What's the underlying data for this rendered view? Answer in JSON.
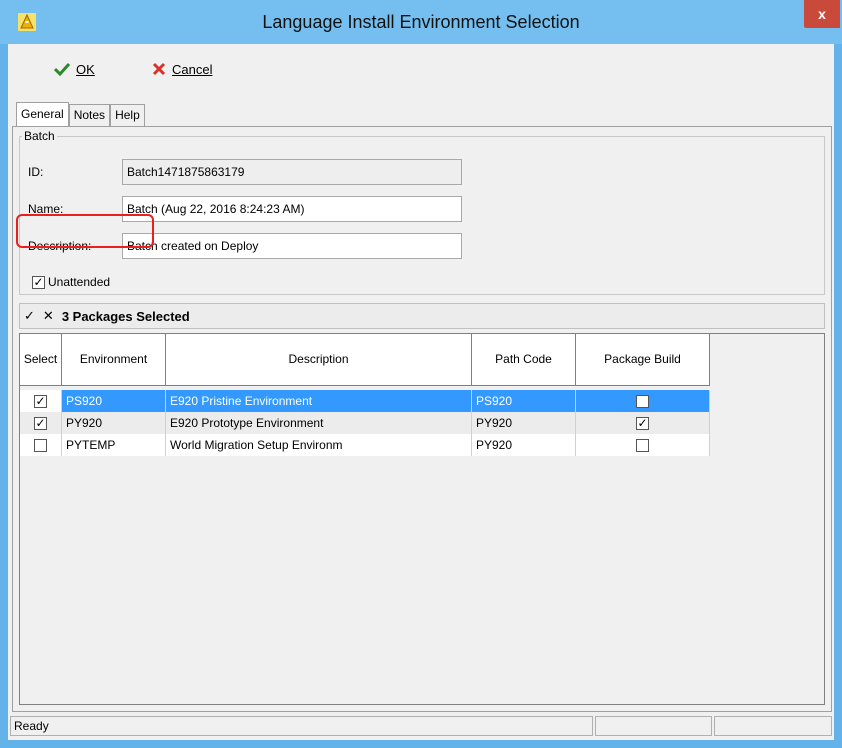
{
  "window": {
    "title": "Language Install Environment Selection",
    "close_label": "x",
    "accent": "#74bff0"
  },
  "toolbar": {
    "ok_label": "OK",
    "cancel_label": "Cancel"
  },
  "tabs": [
    {
      "label": "General",
      "active": true
    },
    {
      "label": "Notes",
      "active": false
    },
    {
      "label": "Help",
      "active": false
    }
  ],
  "batch": {
    "legend": "Batch",
    "id_label": "ID:",
    "id_value": "Batch1471875863179",
    "name_label": "Name:",
    "name_value": "Batch (Aug 22, 2016 8:24:23 AM)",
    "description_label": "Description:",
    "description_value": "Batch created on Deploy",
    "unattended_label": "Unattended",
    "unattended_checked": true
  },
  "selection_bar": {
    "check_all_icon": "checkmark-icon",
    "clear_all_icon": "x-icon",
    "summary": "3 Packages Selected"
  },
  "grid": {
    "headers": [
      "Select",
      "Environment",
      "Description",
      "Path Code",
      "Package Build"
    ],
    "rows": [
      {
        "select": true,
        "environment": "PS920",
        "description": "E920 Pristine Environment",
        "path_code": "PS920",
        "package_build": false,
        "selected_row": true
      },
      {
        "select": true,
        "environment": "PY920",
        "description": "E920 Prototype Environment",
        "path_code": "PY920",
        "package_build": true,
        "selected_row": false
      },
      {
        "select": false,
        "environment": "PYTEMP",
        "description": "World Migration Setup Environm",
        "path_code": "PY920",
        "package_build": false,
        "selected_row": false
      }
    ]
  },
  "status": {
    "text": "Ready"
  },
  "colors": {
    "selection": "#3399ff",
    "highlight_ring": "#e8211e",
    "ok_green": "#2a8a2a",
    "cancel_red": "#d9322b"
  }
}
